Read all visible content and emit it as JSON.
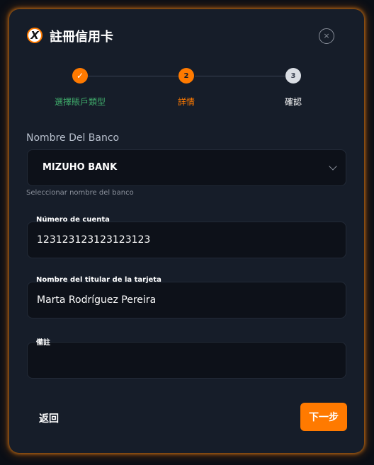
{
  "dialog": {
    "title": "註冊信用卡",
    "logo_text": "X",
    "close_icon": "×"
  },
  "steps": [
    {
      "label": "選擇賬戶類型",
      "status": "completed",
      "icon": "✓"
    },
    {
      "label": "詳情",
      "status": "active",
      "number": "2"
    },
    {
      "label": "確認",
      "status": "pending",
      "number": "3"
    }
  ],
  "bank": {
    "label": "Nombre Del Banco",
    "value": "MIZUHO BANK",
    "helper": "Seleccionar nombre del banco"
  },
  "account_number": {
    "label": "Número de cuenta",
    "value": "123123123123123123"
  },
  "card_holder": {
    "label": "Nombre del titular de la tarjeta",
    "value": "Marta Rodríguez Pereira"
  },
  "notes": {
    "label": "備註",
    "value": ""
  },
  "footer": {
    "back_label": "返回",
    "next_label": "下一步"
  },
  "colors": {
    "accent": "#ff7a00",
    "completed_label": "#3fa96a",
    "background": "#161d29"
  }
}
